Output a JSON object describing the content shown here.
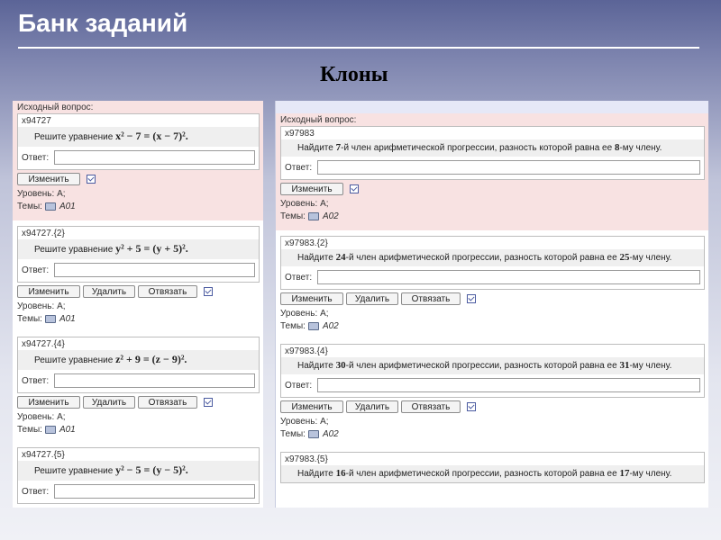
{
  "slide": {
    "title": "Банк заданий",
    "subtitle": "Клоны"
  },
  "labels": {
    "source_question": "Исходный вопрос:",
    "answer": "Ответ:",
    "edit": "Изменить",
    "delete": "Удалить",
    "unlink": "Отвязать",
    "level": "Уровень: А;",
    "topics": "Темы:",
    "task_prefix": "Решите уравнение",
    "seq_a": "Найдите",
    "seq_b": "-й член арифметической прогрессии, разность которой равна ее",
    "seq_c": "-му члену."
  },
  "left": {
    "original": {
      "id": "x94727",
      "equation": "x² − 7 = (x − 7)².",
      "topic": "A01"
    },
    "clones": [
      {
        "id": "x94727.{2}",
        "equation": "y² + 5 = (y + 5)².",
        "topic": "A01"
      },
      {
        "id": "x94727.{4}",
        "equation": "z² + 9 = (z − 9)².",
        "topic": "A01"
      },
      {
        "id": "x94727.{5}",
        "equation": "y² − 5 = (y − 5)²."
      }
    ]
  },
  "right": {
    "original": {
      "id": "x97983",
      "n1": "7",
      "n2": "8",
      "topic": "A02"
    },
    "clones": [
      {
        "id": "x97983.{2}",
        "n1": "24",
        "n2": "25",
        "topic": "A02"
      },
      {
        "id": "x97983.{4}",
        "n1": "30",
        "n2": "31",
        "topic": "A02"
      },
      {
        "id": "x97983.{5}",
        "n1": "16",
        "n2": "17"
      }
    ]
  }
}
